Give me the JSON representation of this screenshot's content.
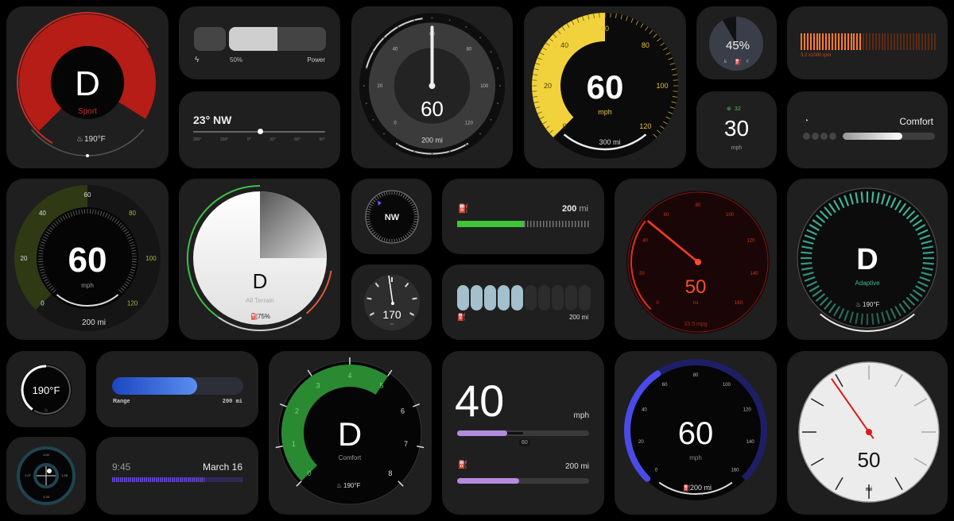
{
  "colors": {
    "background": "#000000",
    "card": "#1f1f1f",
    "sport_red": "#c0201a",
    "yellow": "#f2d23c",
    "olive": "#2f3a14",
    "green": "#43c34a",
    "teal": "#3fb79a",
    "blue": "#4646e0",
    "purple": "#b58be0",
    "orange": "#ff7a2a",
    "needle_red": "#e01818"
  },
  "sport_gauge": {
    "gear": "D",
    "mode": "Sport",
    "temp": "190°F",
    "temp_icon": "coolant-temp-icon"
  },
  "power_bar": {
    "icon": "bolt-icon",
    "percent": "50%",
    "label": "Power",
    "value_percent": 50
  },
  "heading": {
    "value": "23° NW",
    "scale": [
      "300°",
      "330°",
      "0°",
      "30°",
      "60°",
      "90°"
    ]
  },
  "needle_speedo": {
    "speed": "60",
    "range": "200 mi",
    "ticks": [
      "0",
      "20",
      "40",
      "60",
      "80",
      "100",
      "120"
    ]
  },
  "yellow_speedo": {
    "speed": "60",
    "unit": "mph",
    "range": "300 mi",
    "ticks": [
      "0",
      "20",
      "40",
      "60",
      "80",
      "100",
      "120"
    ]
  },
  "fuel_dial": {
    "percent": "45%",
    "empty": "E",
    "full": "F",
    "icon": "fuel-pump-icon"
  },
  "rpm": {
    "label": "3.2 x1000 rpm",
    "lit_fraction": 0.45
  },
  "speed_small": {
    "limit": "32",
    "speed": "30",
    "unit": "mph",
    "icon": "speed-limit-icon"
  },
  "drive_mode": {
    "label": "Comfort",
    "level": 0.65,
    "icon": "gauge-icon"
  },
  "green_speedo": {
    "speed": "60",
    "unit": "mph",
    "range": "200 mi",
    "ticks": [
      "0",
      "20",
      "40",
      "60",
      "80",
      "100",
      "120"
    ]
  },
  "all_terrain": {
    "gear": "D",
    "mode": "All Terrain",
    "fuel": "75%"
  },
  "compass": {
    "heading": "NW"
  },
  "small_dial": {
    "value": "170",
    "unit": "mi"
  },
  "fuel_range": {
    "value": "200",
    "unit": "mi",
    "level": 0.5
  },
  "pill_bars": {
    "range": "200 mi",
    "filled": 5,
    "total": 10
  },
  "red_gauge": {
    "speed": "50",
    "unit": "mi",
    "economy": "33.5 mpg",
    "ticks": [
      "0",
      "20",
      "40",
      "60",
      "80",
      "100",
      "120",
      "140",
      "160"
    ]
  },
  "adaptive_gauge": {
    "gear": "D",
    "mode": "Adaptive",
    "temp": "190°F"
  },
  "temp_ring": {
    "temp": "190°F"
  },
  "range_bar": {
    "label": "Range",
    "value": "200 mi",
    "level": 0.65
  },
  "crosshair": {
    "top": "1.02",
    "right": "1.28",
    "bottom": "1.26",
    "left": "1.07"
  },
  "clock": {
    "time": "9:45",
    "date": "March 16",
    "level": 0.7
  },
  "comfort_tach": {
    "gear": "D",
    "mode": "Comfort",
    "temp": "190°F",
    "ticks": [
      "0",
      "1",
      "2",
      "3",
      "4",
      "5",
      "6",
      "7",
      "8"
    ]
  },
  "speed_40": {
    "speed": "40",
    "unit": "mph",
    "limit": "60",
    "range": "200 mi",
    "speed_level": 0.38,
    "range_level": 0.47
  },
  "blue_speedo": {
    "speed": "60",
    "unit": "mph",
    "range": "200 mi",
    "ticks": [
      "0",
      "20",
      "40",
      "60",
      "80",
      "100",
      "120",
      "140",
      "160"
    ]
  },
  "white_dial": {
    "value": "50",
    "unit": "mi"
  }
}
